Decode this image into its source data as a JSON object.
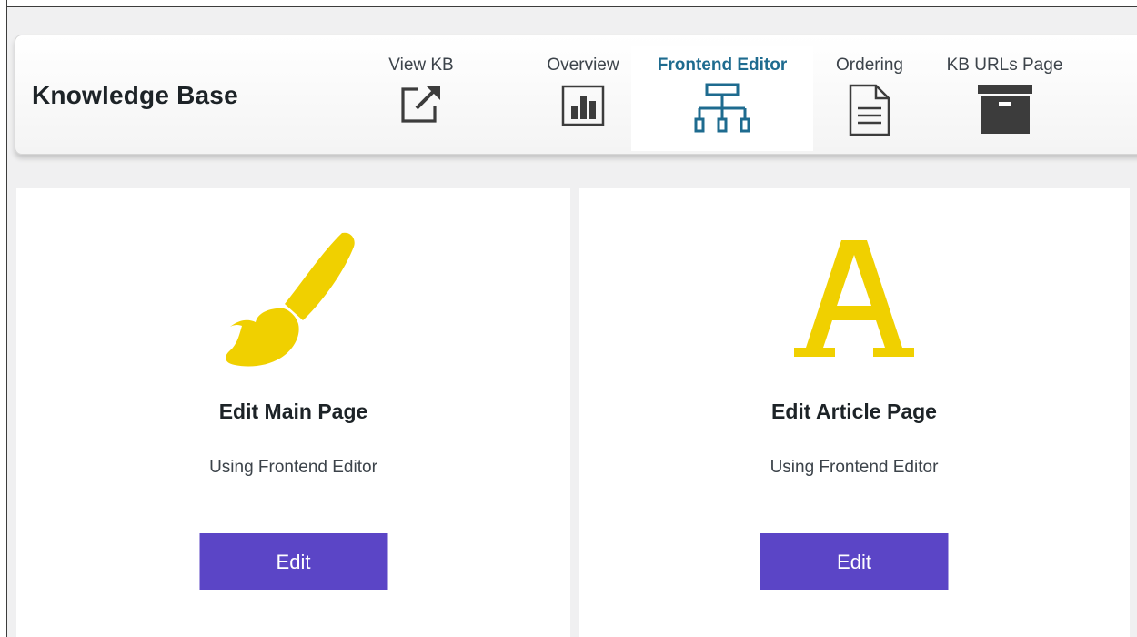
{
  "header": {
    "title": "Knowledge Base"
  },
  "nav": {
    "tabs": [
      {
        "label": "View KB",
        "icon": "external-link-icon"
      },
      {
        "label": "Overview",
        "icon": "bar-chart-icon"
      },
      {
        "label": "Frontend Editor",
        "icon": "hierarchy-icon",
        "active": true
      },
      {
        "label": "Ordering",
        "icon": "document-icon"
      },
      {
        "label": "KB URLs Page",
        "icon": "archive-box-icon"
      }
    ]
  },
  "cards": [
    {
      "icon": "paintbrush-icon",
      "title": "Edit Main Page",
      "subtitle": "Using Frontend Editor",
      "button_label": "Edit"
    },
    {
      "icon": "letter-a-icon",
      "title": "Edit Article Page",
      "subtitle": "Using Frontend Editor",
      "button_label": "Edit"
    }
  ],
  "colors": {
    "accent_button": "#5b45c6",
    "active_tab_text": "#1e6b8f",
    "icon_yellow": "#f0d000",
    "icon_dark": "#3c3c3c"
  }
}
